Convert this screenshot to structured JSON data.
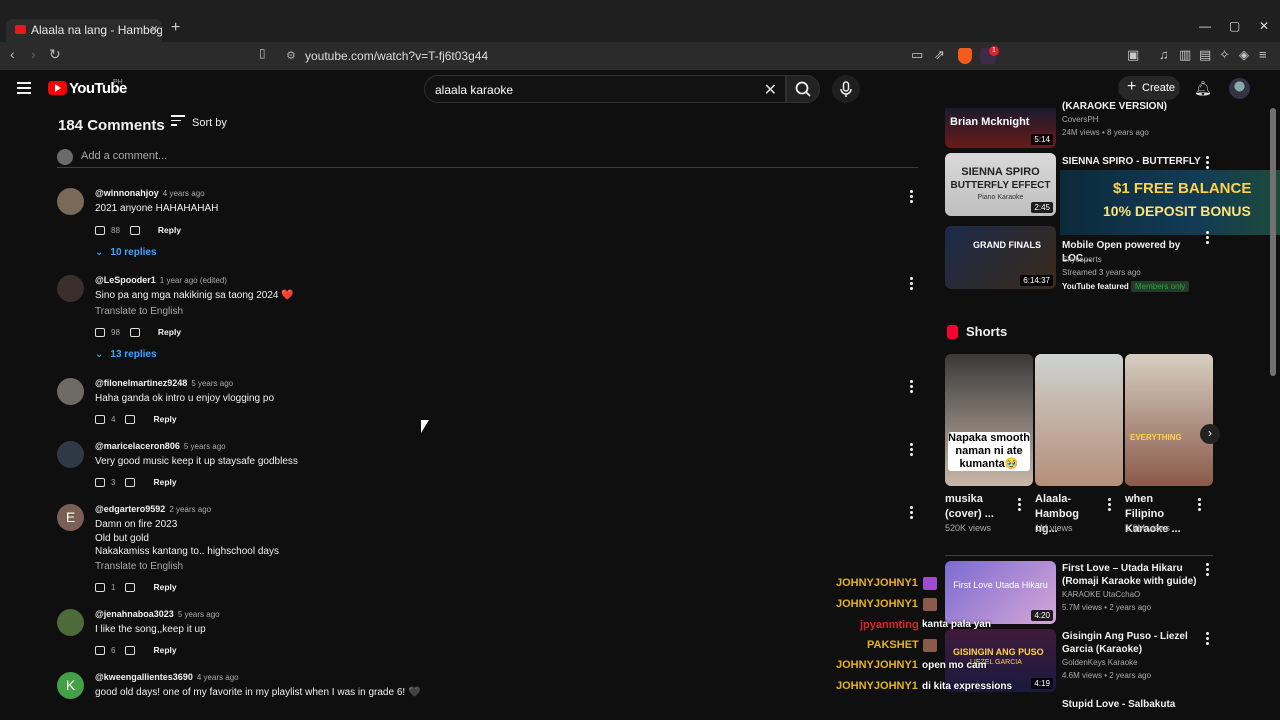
{
  "browser": {
    "tab_title": "Alaala na lang - Hambog ng Sag",
    "new_tab": "+",
    "url": "youtube.com/watch?v=T-fj6t03g44",
    "reward_count": "1"
  },
  "header": {
    "logo_text": "YouTube",
    "country": "PH",
    "search_value": "alaala karaoke",
    "create_label": "Create"
  },
  "comments_section": {
    "count_label": "184 Comments",
    "sort_label": "Sort by",
    "add_placeholder": "Add a comment...",
    "reply_label": "Reply",
    "translate_label": "Translate to English",
    "comments": [
      {
        "handle": "@winnonahjoy",
        "time": "4 years ago",
        "lines": [
          "2021 anyone HAHAHAHAH"
        ],
        "likes": "88",
        "replies": "10 replies"
      },
      {
        "handle": "@LeSpooder1",
        "time": "1 year ago (edited)",
        "lines": [
          "Sino pa ang mga nakikinig sa taong 2024 ❤️"
        ],
        "likes": "98",
        "replies": "13 replies"
      },
      {
        "handle": "@filonelmartinez9248",
        "time": "5 years ago",
        "lines": [
          "Haha ganda ok intro u enjoy vlogging po"
        ],
        "likes": "4"
      },
      {
        "handle": "@maricelaceron806",
        "time": "5 years ago",
        "lines": [
          "Very good music keep it up staysafe godbless"
        ],
        "likes": "3"
      },
      {
        "handle": "@edgartero9592",
        "time": "2 years ago",
        "avatar_letter": "E",
        "lines": [
          "Damn on fire 2023",
          "Old but gold",
          "Nakakamiss kantang to.. highschool days"
        ],
        "likes": "1"
      },
      {
        "handle": "@jenahnaboa3023",
        "time": "5 years ago",
        "lines": [
          "I like the song,,keep it up"
        ],
        "likes": "6"
      },
      {
        "handle": "@kweengallientes3690",
        "time": "4 years ago",
        "avatar_letter": "K",
        "lines": [
          "good old days!  one of my favorite in my playlist when I was in grade 6! 🖤"
        ]
      }
    ]
  },
  "sidebar": {
    "videos": [
      {
        "title": "(KARAOKE VERSION)",
        "channel": "CoversPH",
        "stats": "24M views • 8 years ago",
        "duration": "5:14",
        "thumb_text": "Brian Mcknight"
      },
      {
        "title": "SIENNA SPIRO - BUTTERFLY",
        "duration": "2:45",
        "thumb_line1": "SIENNA SPIRO",
        "thumb_line2": "BUTTERFLY EFFECT",
        "thumb_line3": "Piano Karaoke"
      },
      {
        "title": "Mobile Open powered by LOC...",
        "channel": "Skyesports",
        "stats": "Streamed 3 years ago",
        "duration": "6:14:37",
        "badge_featured": "YouTube featured",
        "badge_members": "Members only",
        "thumb_text": "GRAND FINALS"
      },
      {
        "title": "First Love – Utada Hikaru (Romaji Karaoke with guide)",
        "channel": "KARAOKE UtaCchaO",
        "stats": "5.7M views • 2 years ago",
        "duration": "4:20",
        "thumb_text": "First Love Utada Hikaru"
      },
      {
        "title": "Gisingin Ang Puso - Liezel Garcia (Karaoke)",
        "channel": "GoldenKeys Karaoke",
        "stats": "4.6M views • 2 years ago",
        "duration": "4:19",
        "thumb_text": "GISINGIN ANG PUSO",
        "thumb_sub": "LIEZEL GARCIA"
      },
      {
        "title": "Stupid Love - Salbakuta"
      }
    ],
    "ad": {
      "line1": "$1 FREE BALANCE",
      "line2": "10% DEPOSIT BONUS"
    },
    "shorts_label": "Shorts",
    "shorts": [
      {
        "title": "musika (cover) ...",
        "views": "520K views",
        "caption": "Napaka smooth naman ni ate kumanta🥹"
      },
      {
        "title": "Alaala-Hambog ng...",
        "views": "1M views"
      },
      {
        "title": "when Filipino Karaoke ...",
        "views": "1.6M views",
        "caption": "EVERYTHING"
      }
    ]
  },
  "chat_overlay": [
    {
      "name": "JOHNYJOHNY1",
      "msg": ""
    },
    {
      "name": "JOHNYJOHNY1",
      "msg": ""
    },
    {
      "name": "jpyanmting",
      "msg": "kanta pala yan"
    },
    {
      "name": "PAKSHET",
      "msg": ""
    },
    {
      "name": "JOHNYJOHNY1",
      "msg": "open mo cam"
    },
    {
      "name": "JOHNYJOHNY1",
      "msg": "di kita expressions"
    }
  ],
  "colors": {
    "accent_link": "#3ea6ff",
    "brand_red": "#ff0000",
    "chat_name": "#e7b415",
    "chat_name_alt": "#e0212b"
  }
}
